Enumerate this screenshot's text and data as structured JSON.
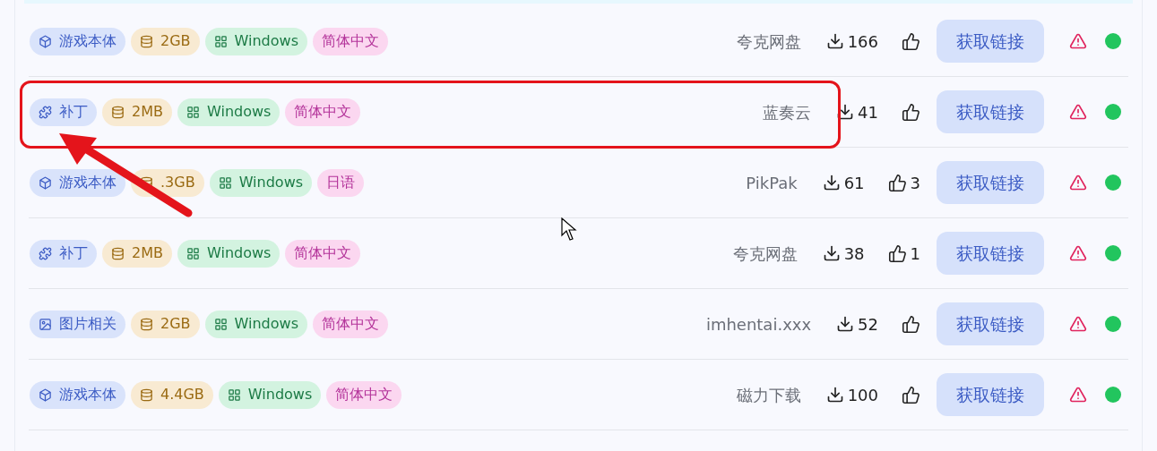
{
  "rows": [
    {
      "highlighted": false,
      "tags": [
        {
          "kind": "game",
          "label": "游戏本体"
        },
        {
          "kind": "size",
          "label": "2GB"
        },
        {
          "kind": "os",
          "label": "Windows"
        },
        {
          "kind": "language",
          "label": "简体中文"
        }
      ],
      "source": "夸克网盘",
      "downloads": "166",
      "button": "获取链接"
    },
    {
      "highlighted": true,
      "tags": [
        {
          "kind": "patch",
          "label": "补丁"
        },
        {
          "kind": "size",
          "label": "2MB"
        },
        {
          "kind": "os",
          "label": "Windows"
        },
        {
          "kind": "language",
          "label": "简体中文"
        }
      ],
      "source": "蓝奏云",
      "downloads": "41",
      "button": "获取链接"
    },
    {
      "highlighted": false,
      "tags": [
        {
          "kind": "game",
          "label": "游戏本体"
        },
        {
          "kind": "size",
          "label": ".3GB"
        },
        {
          "kind": "os",
          "label": "Windows"
        },
        {
          "kind": "language",
          "label": "日语"
        }
      ],
      "source": "PikPak",
      "downloads": "61",
      "likes": "3",
      "button": "获取链接"
    },
    {
      "highlighted": false,
      "tags": [
        {
          "kind": "patch",
          "label": "补丁"
        },
        {
          "kind": "size",
          "label": "2MB"
        },
        {
          "kind": "os",
          "label": "Windows"
        },
        {
          "kind": "language",
          "label": "简体中文"
        }
      ],
      "source": "夸克网盘",
      "downloads": "38",
      "likes": "1",
      "button": "获取链接"
    },
    {
      "highlighted": false,
      "tags": [
        {
          "kind": "image",
          "label": "图片相关"
        },
        {
          "kind": "size",
          "label": "2GB"
        },
        {
          "kind": "os",
          "label": "Windows"
        },
        {
          "kind": "language",
          "label": "简体中文"
        }
      ],
      "source": "imhentai.xxx",
      "downloads": "52",
      "button": "获取链接"
    },
    {
      "highlighted": false,
      "tags": [
        {
          "kind": "game",
          "label": "游戏本体"
        },
        {
          "kind": "size",
          "label": "4.4GB"
        },
        {
          "kind": "os",
          "label": "Windows"
        },
        {
          "kind": "language",
          "label": "简体中文"
        }
      ],
      "source": "磁力下载",
      "downloads": "100",
      "button": "获取链接"
    }
  ]
}
